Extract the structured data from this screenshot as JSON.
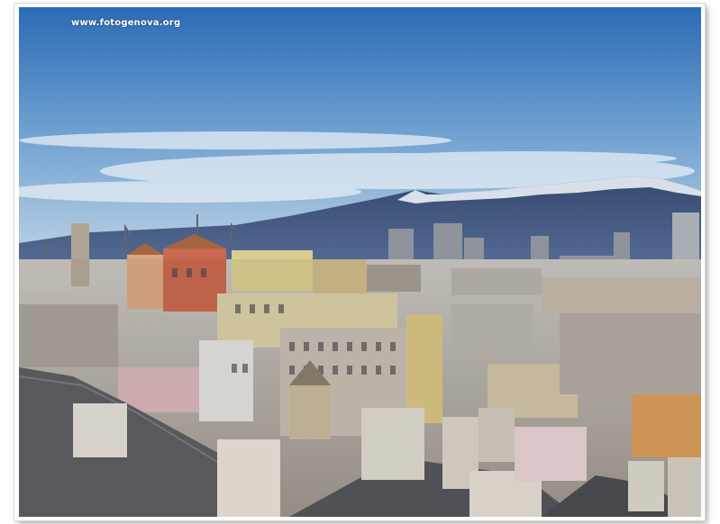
{
  "photo": {
    "watermark": "www.fotogenova.org",
    "subject": "genoa-cityscape",
    "colors": {
      "sky_top": "#2f6fb8",
      "sky_bottom": "#bcd3e6",
      "mountains": "#3c4f75",
      "snow": "#e8eef4",
      "roofs": "#5a5a5e",
      "facade_light": "#e8dccb"
    }
  }
}
